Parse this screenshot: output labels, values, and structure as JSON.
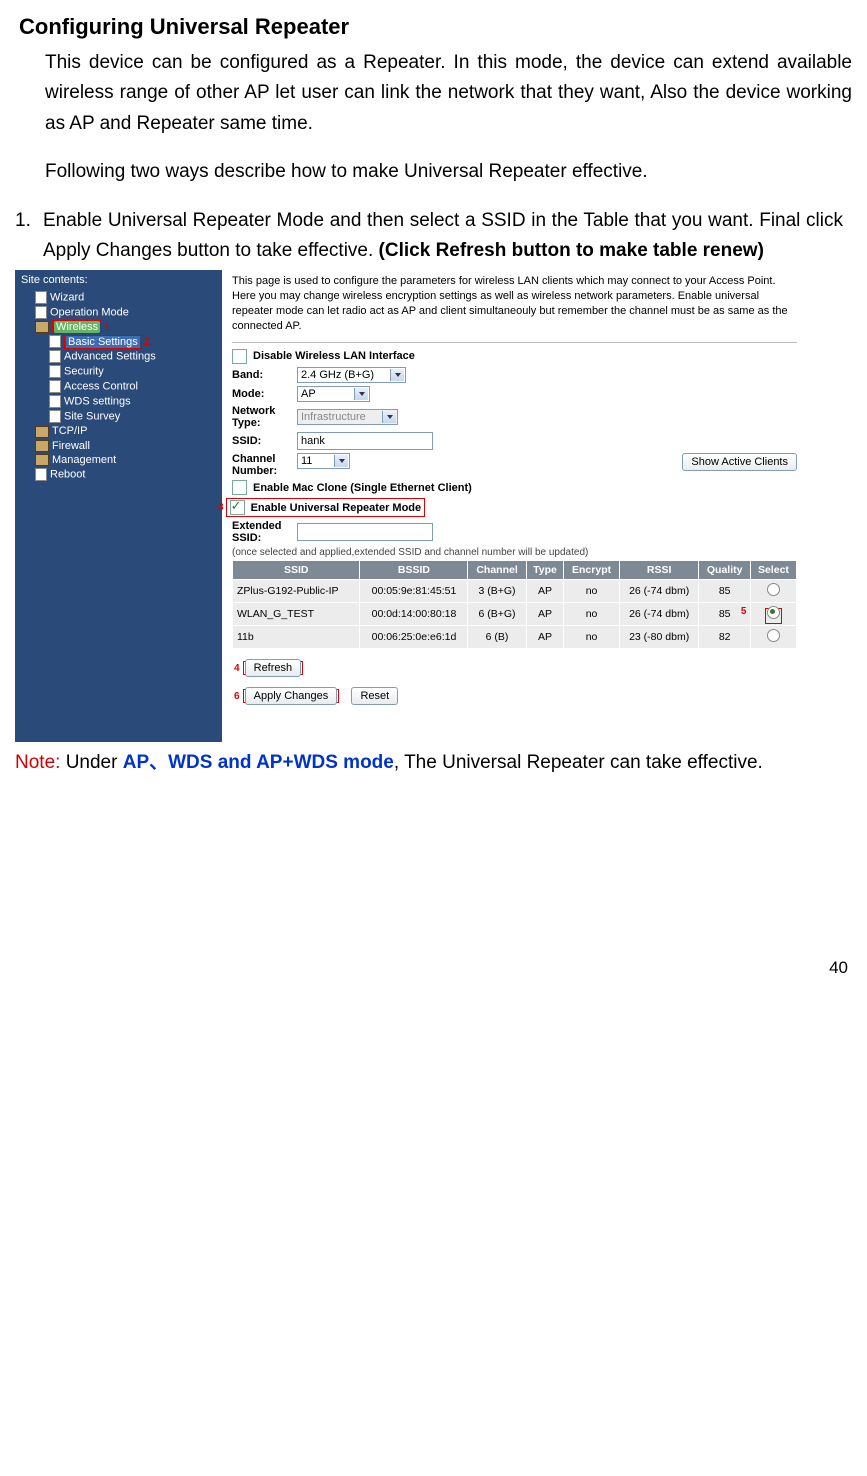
{
  "heading": "Configuring Universal Repeater",
  "para1": "This device can be configured as a Repeater. In this mode, the device can extend available wireless range of other AP let user can link the network that they want, Also the device working as AP and Repeater same time.",
  "para2": "Following two ways describe how to make Universal Repeater effective.",
  "step1_num": "1.",
  "step1_a": "Enable Universal Repeater Mode and then select a SSID in the Table that you want. Final click Apply Changes button to take effective. ",
  "step1_b": "(Click Refresh button to make table renew)",
  "sidebar": {
    "title": "Site contents:",
    "wizard": "Wizard",
    "opmode": "Operation Mode",
    "wireless": "Wireless",
    "basic": "Basic Settings",
    "advanced": "Advanced Settings",
    "security": "Security",
    "access": "Access Control",
    "wds": "WDS settings",
    "survey": "Site Survey",
    "tcpip": "TCP/IP",
    "firewall": "Firewall",
    "management": "Management",
    "reboot": "Reboot"
  },
  "anno": {
    "n1": "1",
    "n2": "2",
    "n3": "3",
    "n4": "4",
    "n5": "5",
    "n6": "6"
  },
  "main": {
    "desc": "This page is used to configure the parameters for wireless LAN clients which may connect to your Access Point. Here you may change wireless encryption settings as well as wireless network parameters. Enable universal repeater mode can let radio act as AP and client simultaneouly but remember the channel must be as same as the connected AP.",
    "disable_lbl": "Disable Wireless LAN Interface",
    "band_lbl": "Band:",
    "band_val": "2.4 GHz (B+G)",
    "mode_lbl": "Mode:",
    "mode_val": "AP",
    "nettype_lbl": "Network Type:",
    "nettype_val": "Infrastructure",
    "ssid_lbl": "SSID:",
    "ssid_val": "hank",
    "chan_lbl": "Channel Number:",
    "chan_val": "11",
    "show_clients": "Show Active Clients",
    "mac_clone": "Enable Mac Clone (Single Ethernet Client)",
    "urepeater": "Enable Universal Repeater Mode",
    "ext_ssid_lbl": "Extended SSID:",
    "ext_ssid_val": "",
    "ext_note": "(once selected and applied,extended SSID and channel number will be updated)",
    "refresh": "Refresh",
    "apply": "Apply Changes",
    "reset": "Reset"
  },
  "table": {
    "headers": {
      "ssid": "SSID",
      "bssid": "BSSID",
      "channel": "Channel",
      "type": "Type",
      "encrypt": "Encrypt",
      "rssi": "RSSI",
      "quality": "Quality",
      "select": "Select"
    },
    "rows": [
      {
        "ssid": "ZPlus-G192-Public-IP",
        "bssid": "00:05:9e:81:45:51",
        "channel": "3 (B+G)",
        "type": "AP",
        "encrypt": "no",
        "rssi": "26 (-74 dbm)",
        "quality": "85",
        "selected": false
      },
      {
        "ssid": "WLAN_G_TEST",
        "bssid": "00:0d:14:00:80:18",
        "channel": "6 (B+G)",
        "type": "AP",
        "encrypt": "no",
        "rssi": "26 (-74 dbm)",
        "quality": "85",
        "selected": true
      },
      {
        "ssid": "11b",
        "bssid": "00:06:25:0e:e6:1d",
        "channel": "6 (B)",
        "type": "AP",
        "encrypt": "no",
        "rssi": "23 (-80 dbm)",
        "quality": "82",
        "selected": false
      }
    ]
  },
  "note": {
    "prefix": "Note:",
    "mid": " Under ",
    "blue": "AP、WDS and AP+WDS mode",
    "suffix": ", The Universal Repeater can take effective."
  },
  "page_num": "40"
}
